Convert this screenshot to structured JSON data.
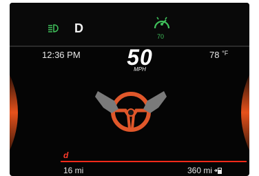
{
  "status_bar": {
    "gear": "D",
    "cruise_set_speed": "70",
    "icons": [
      "headlamp-icon",
      "cruise-control-icon"
    ]
  },
  "info_row": {
    "time": "12:36 PM",
    "temperature_value": "78",
    "temperature_unit": "°F"
  },
  "speedometer": {
    "value": "50",
    "unit": "MPH"
  },
  "center_graphic": {
    "icon": "steering-wheel-hands-icon"
  },
  "drive_mode": "d",
  "bottom": {
    "trip_distance": "16 mi",
    "range_value": "360 mi",
    "range_icon": "fuel-pump-icon"
  },
  "colors": {
    "background": "#050505",
    "accent_green": "#3fbf5a",
    "accent_orange": "#ff5a1e",
    "accent_red": "#ff2a1a",
    "text": "#e8e8e8"
  }
}
